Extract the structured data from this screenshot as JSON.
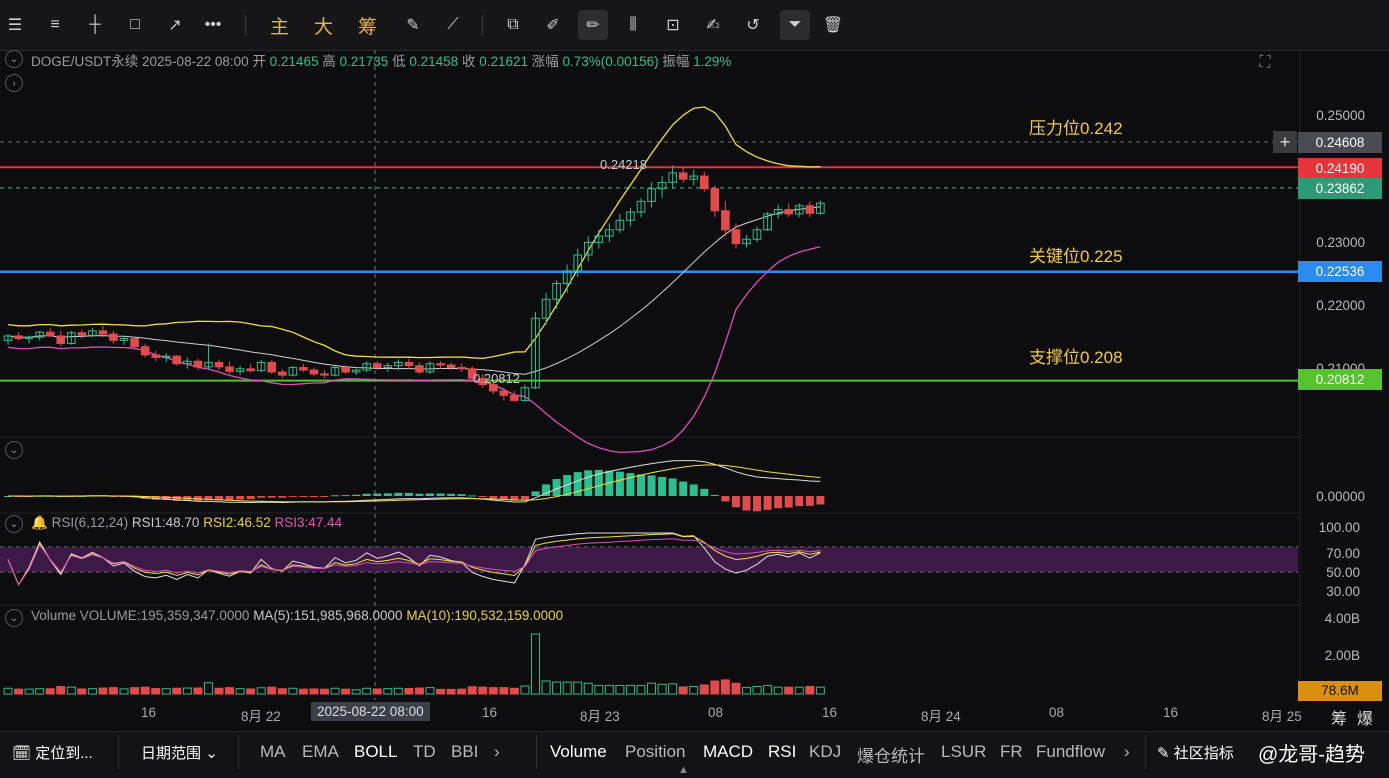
{
  "toolbar": {
    "zh_main": "主",
    "zh_big": "大",
    "zh_chips": "筹"
  },
  "info": {
    "symbol": "DOGE/USDT永续",
    "datetime": "2025-08-22 08:00",
    "open_label": "开",
    "open": "0.21465",
    "high_label": "高",
    "high": "0.21735",
    "low_label": "低",
    "low": "0.21458",
    "close_label": "收",
    "close": "0.21621",
    "change_label": "涨幅",
    "change": "0.73%(0.00156)",
    "amp_label": "振幅",
    "amp": "1.29%"
  },
  "levels": {
    "resistance_label": "压力位0.242",
    "key_label": "关键位0.225",
    "support_label": "支撑位0.208"
  },
  "price_tags": {
    "crosshair": "0.24608",
    "resistance": "0.24190",
    "last": "0.23862",
    "key": "0.22536",
    "support": "0.20812"
  },
  "price_axis": {
    "p1": "0.25000",
    "p2": "0.23000",
    "p3": "0.22000",
    "p4": "0.21000"
  },
  "annotations": {
    "high_mark": "0.24218",
    "low_mark": "0.20812"
  },
  "macd": {
    "zero": "0.00000"
  },
  "rsi": {
    "title": "RSI(6,12,24)",
    "rsi1": "RSI1:48.70",
    "rsi2": "RSI2:46.52",
    "rsi3": "RSI3:47.44",
    "axis": [
      "100.00",
      "70.00",
      "50.00",
      "30.00"
    ]
  },
  "volume": {
    "title": "Volume",
    "value": "VOLUME:195,359,347.0000",
    "ma5": "MA(5):151,985,968.0000",
    "ma10": "MA(10):190,532,159.0000",
    "axis": [
      "4.00B",
      "2.00B"
    ],
    "last_tag": "78.6M"
  },
  "time_axis": {
    "t1": "16",
    "t2": "8月 22",
    "t_cross": "2025-08-22 08:00",
    "t3": "16",
    "t4": "8月 23",
    "t5": "08",
    "t6": "16",
    "t7": "8月 24",
    "t8": "08",
    "t9": "16",
    "t10": "8月 25",
    "right1": "筹",
    "right2": "爆"
  },
  "bottom": {
    "locate": "定位到...",
    "date_range": "日期范围",
    "ma": "MA",
    "ema": "EMA",
    "boll": "BOLL",
    "td": "TD",
    "bbi": "BBI",
    "volume": "Volume",
    "position": "Position",
    "macd": "MACD",
    "rsi": "RSI",
    "kdj": "KDJ",
    "liq": "爆仓统计",
    "lsur": "LSUR",
    "fr": "FR",
    "fundflow": "Fundflow",
    "community": "社区指标",
    "watermark": "@龙哥-趋势"
  },
  "colors": {
    "up": "#2cbf8f",
    "down": "#e04b4b",
    "resistance": "#e5343a",
    "key": "#2a8cf0",
    "support": "#55c22e",
    "boll_mid": "#cfcfd3",
    "boll_up": "#f0e03a",
    "boll_low": "#e04cc0"
  },
  "chart_data": {
    "type": "candlestick",
    "title": "DOGE/USDT永续",
    "ylim": [
      0.2065,
      0.2535
    ],
    "levels": [
      0.242,
      0.225,
      0.208
    ],
    "candles": [
      [
        0.2145,
        0.2155,
        0.2138,
        0.2152
      ],
      [
        0.2152,
        0.2158,
        0.2145,
        0.2148
      ],
      [
        0.2148,
        0.2153,
        0.214,
        0.215
      ],
      [
        0.215,
        0.216,
        0.2145,
        0.2158
      ],
      [
        0.2158,
        0.2165,
        0.215,
        0.2152
      ],
      [
        0.2152,
        0.216,
        0.2135,
        0.214
      ],
      [
        0.214,
        0.216,
        0.2138,
        0.2157
      ],
      [
        0.2157,
        0.2162,
        0.2148,
        0.2153
      ],
      [
        0.2153,
        0.2165,
        0.215,
        0.216
      ],
      [
        0.216,
        0.2168,
        0.215,
        0.2155
      ],
      [
        0.2155,
        0.216,
        0.214,
        0.2145
      ],
      [
        0.2145,
        0.2152,
        0.2138,
        0.2148
      ],
      [
        0.2148,
        0.215,
        0.213,
        0.2135
      ],
      [
        0.2135,
        0.214,
        0.2118,
        0.2122
      ],
      [
        0.2122,
        0.2128,
        0.2112,
        0.2118
      ],
      [
        0.2118,
        0.2125,
        0.211,
        0.212
      ],
      [
        0.212,
        0.2122,
        0.2105,
        0.2108
      ],
      [
        0.2108,
        0.2118,
        0.21,
        0.2112
      ],
      [
        0.2112,
        0.2116,
        0.2098,
        0.2103
      ],
      [
        0.2103,
        0.214,
        0.2098,
        0.211
      ],
      [
        0.211,
        0.2115,
        0.2098,
        0.2103
      ],
      [
        0.2103,
        0.2112,
        0.2092,
        0.2096
      ],
      [
        0.2096,
        0.2105,
        0.209,
        0.21
      ],
      [
        0.21,
        0.2108,
        0.2094,
        0.2097
      ],
      [
        0.2097,
        0.2114,
        0.2095,
        0.211
      ],
      [
        0.211,
        0.2114,
        0.2092,
        0.2095
      ],
      [
        0.2095,
        0.21,
        0.2085,
        0.209
      ],
      [
        0.209,
        0.2105,
        0.2088,
        0.2102
      ],
      [
        0.2102,
        0.2108,
        0.2095,
        0.2098
      ],
      [
        0.2098,
        0.2102,
        0.2088,
        0.2092
      ],
      [
        0.2092,
        0.2098,
        0.2085,
        0.209
      ],
      [
        0.209,
        0.2105,
        0.2088,
        0.2102
      ],
      [
        0.2102,
        0.2105,
        0.2092,
        0.2095
      ],
      [
        0.2095,
        0.21,
        0.209,
        0.2098
      ],
      [
        0.2098,
        0.2112,
        0.2095,
        0.2108
      ],
      [
        0.2108,
        0.2112,
        0.2098,
        0.2102
      ],
      [
        0.2102,
        0.211,
        0.2095,
        0.2105
      ],
      [
        0.2105,
        0.2115,
        0.2098,
        0.211
      ],
      [
        0.211,
        0.2116,
        0.21,
        0.2105
      ],
      [
        0.2105,
        0.211,
        0.2092,
        0.2095
      ],
      [
        0.2095,
        0.2112,
        0.2092,
        0.2108
      ],
      [
        0.2108,
        0.2112,
        0.21,
        0.2106
      ],
      [
        0.2106,
        0.211,
        0.2098,
        0.2102
      ],
      [
        0.2102,
        0.2108,
        0.2095,
        0.21
      ],
      [
        0.21,
        0.2104,
        0.208,
        0.2085
      ],
      [
        0.2085,
        0.2092,
        0.207,
        0.2075
      ],
      [
        0.2075,
        0.208,
        0.206,
        0.2065
      ],
      [
        0.2065,
        0.207,
        0.205,
        0.2058
      ],
      [
        0.2058,
        0.2065,
        0.2048,
        0.205
      ],
      [
        0.205,
        0.2075,
        0.2048,
        0.207
      ],
      [
        0.207,
        0.219,
        0.2068,
        0.218
      ],
      [
        0.218,
        0.222,
        0.217,
        0.221
      ],
      [
        0.221,
        0.224,
        0.2195,
        0.2235
      ],
      [
        0.2235,
        0.2265,
        0.222,
        0.2255
      ],
      [
        0.2255,
        0.229,
        0.2245,
        0.228
      ],
      [
        0.228,
        0.231,
        0.227,
        0.23
      ],
      [
        0.23,
        0.232,
        0.229,
        0.231
      ],
      [
        0.231,
        0.233,
        0.23,
        0.232
      ],
      [
        0.232,
        0.2345,
        0.2315,
        0.2335
      ],
      [
        0.2335,
        0.2355,
        0.2325,
        0.2348
      ],
      [
        0.2348,
        0.237,
        0.234,
        0.2365
      ],
      [
        0.2365,
        0.2395,
        0.2355,
        0.2385
      ],
      [
        0.2385,
        0.2405,
        0.237,
        0.2395
      ],
      [
        0.2395,
        0.2422,
        0.2385,
        0.241
      ],
      [
        0.241,
        0.2418,
        0.2395,
        0.24
      ],
      [
        0.24,
        0.2415,
        0.239,
        0.2405
      ],
      [
        0.2405,
        0.2412,
        0.238,
        0.2385
      ],
      [
        0.2385,
        0.239,
        0.234,
        0.235
      ],
      [
        0.235,
        0.2365,
        0.231,
        0.232
      ],
      [
        0.232,
        0.233,
        0.229,
        0.2298
      ],
      [
        0.2298,
        0.2312,
        0.2292,
        0.2305
      ],
      [
        0.2305,
        0.2325,
        0.23,
        0.232
      ],
      [
        0.232,
        0.2348,
        0.2318,
        0.2345
      ],
      [
        0.2345,
        0.236,
        0.2338,
        0.2352
      ],
      [
        0.2352,
        0.2362,
        0.234,
        0.2345
      ],
      [
        0.2345,
        0.2362,
        0.234,
        0.2358
      ],
      [
        0.2358,
        0.2365,
        0.234,
        0.2346
      ],
      [
        0.2346,
        0.2366,
        0.2344,
        0.2362
      ]
    ]
  }
}
